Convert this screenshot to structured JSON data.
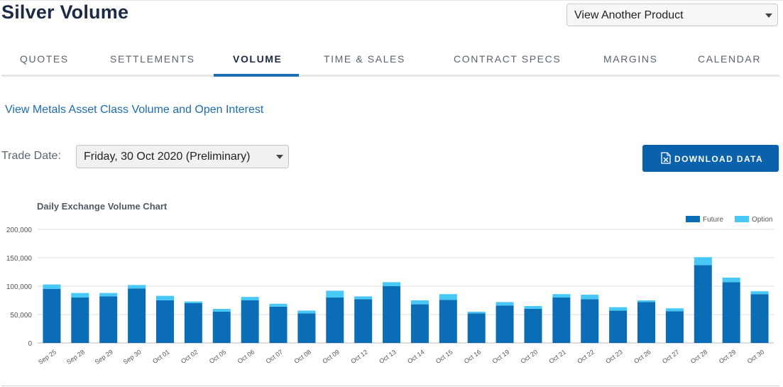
{
  "page": {
    "title": "Silver Volume",
    "product_select": {
      "value": "View Another Product"
    },
    "tabs": [
      {
        "label": "QUOTES",
        "active": false
      },
      {
        "label": "SETTLEMENTS",
        "active": false
      },
      {
        "label": "VOLUME",
        "active": true
      },
      {
        "label": "TIME & SALES",
        "active": false
      },
      {
        "label": "CONTRACT SPECS",
        "active": false
      },
      {
        "label": "MARGINS",
        "active": false
      },
      {
        "label": "CALENDAR",
        "active": false
      }
    ],
    "metals_link": "View Metals Asset Class Volume and Open Interest",
    "trade_date": {
      "label": "Trade Date:",
      "value": "Friday, 30 Oct 2020 (Preliminary)"
    },
    "download_button": {
      "label": "DOWNLOAD DATA",
      "icon": "excel-file-icon"
    }
  },
  "colors": {
    "future": "#0b6db5",
    "option": "#47c8f5",
    "accent": "#1c6fb3",
    "button": "#0b62ac"
  },
  "chart_data": {
    "type": "bar",
    "stacked": true,
    "title": "Daily Exchange Volume Chart",
    "legend_position": "top-right",
    "grid": true,
    "ylim": [
      0,
      200000
    ],
    "yticks": [
      "0",
      "50,000",
      "100,000",
      "150,000",
      "200,000"
    ],
    "ytick_values": [
      0,
      50000,
      100000,
      150000,
      200000
    ],
    "categories": [
      "Sep 25",
      "Sep 28",
      "Sep 29",
      "Sep 30",
      "Oct 01",
      "Oct 02",
      "Oct 05",
      "Oct 06",
      "Oct 07",
      "Oct 08",
      "Oct 09",
      "Oct 12",
      "Oct 13",
      "Oct 14",
      "Oct 15",
      "Oct 16",
      "Oct 19",
      "Oct 20",
      "Oct 21",
      "Oct 22",
      "Oct 23",
      "Oct 26",
      "Oct 27",
      "Oct 28",
      "Oct 29",
      "Oct 30"
    ],
    "series": [
      {
        "name": "Future",
        "color": "#0b6db5",
        "values": [
          95000,
          80000,
          82000,
          96000,
          75000,
          70000,
          55000,
          75000,
          64000,
          52000,
          80000,
          77000,
          100000,
          68000,
          76000,
          52000,
          66000,
          60000,
          80000,
          77000,
          57000,
          72000,
          56000,
          137000,
          107000,
          86000
        ]
      },
      {
        "name": "Option",
        "color": "#47c8f5",
        "values": [
          8000,
          8000,
          6000,
          6000,
          8000,
          3000,
          5000,
          6000,
          5000,
          5000,
          12000,
          5000,
          7000,
          7000,
          10000,
          3000,
          6000,
          5000,
          6000,
          8000,
          6000,
          3000,
          5000,
          14000,
          8000,
          5000
        ]
      }
    ]
  }
}
